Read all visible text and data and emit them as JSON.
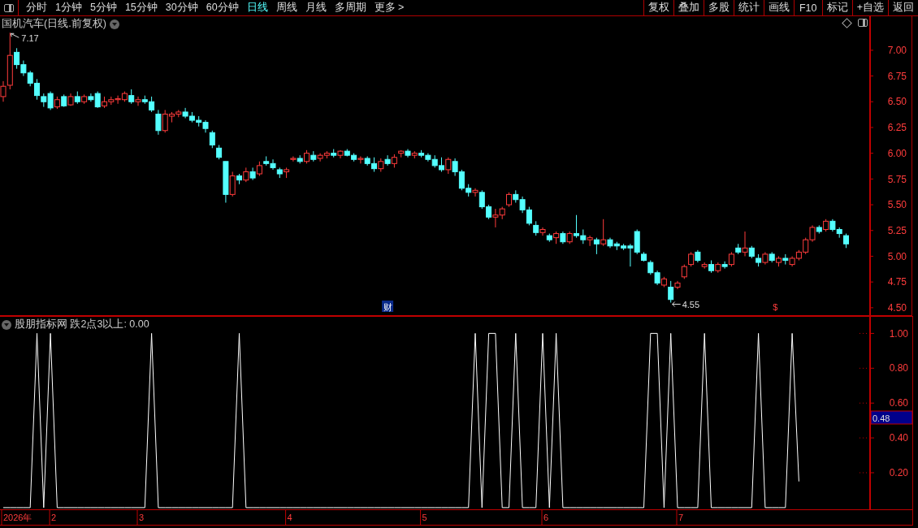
{
  "toolbar": {
    "periods": [
      {
        "label": "分时",
        "selected": false
      },
      {
        "label": "1分钟",
        "selected": false
      },
      {
        "label": "5分钟",
        "selected": false
      },
      {
        "label": "15分钟",
        "selected": false
      },
      {
        "label": "30分钟",
        "selected": false
      },
      {
        "label": "60分钟",
        "selected": false
      },
      {
        "label": "日线",
        "selected": true
      },
      {
        "label": "周线",
        "selected": false
      },
      {
        "label": "月线",
        "selected": false
      },
      {
        "label": "多周期",
        "selected": false
      },
      {
        "label": "更多 >",
        "selected": false
      }
    ],
    "actions": [
      "复权",
      "叠加",
      "多股",
      "统计",
      "画线",
      "F10",
      "标记",
      "+自选",
      "返回"
    ]
  },
  "main_chart": {
    "title": "国机汽车(日线.前复权)",
    "high_label": "7.17",
    "low_label": "4.55",
    "event_badges": [
      {
        "label": "财",
        "kind": "finance"
      },
      {
        "label": "$",
        "kind": "dividend"
      }
    ],
    "chart_data": {
      "type": "candlestick",
      "yticks": [
        {
          "value": 7,
          "label": "7.00"
        },
        {
          "value": 6.75,
          "label": "6.75"
        },
        {
          "value": 6.5,
          "label": "6.50"
        },
        {
          "value": 6.25,
          "label": "6.25"
        },
        {
          "value": 6,
          "label": "6.00"
        },
        {
          "value": 5.75,
          "label": "5.75"
        },
        {
          "value": 5.5,
          "label": "5.50"
        },
        {
          "value": 5.25,
          "label": "5.25"
        },
        {
          "value": 5,
          "label": "5.00"
        },
        {
          "value": 4.75,
          "label": "4.75"
        },
        {
          "value": 4.5,
          "label": "4.50"
        }
      ],
      "ylim": [
        4.42,
        7.33
      ],
      "categories": [
        null,
        null,
        null,
        null,
        null,
        null,
        null,
        null,
        null,
        null,
        null,
        null,
        null,
        null,
        null,
        null,
        null,
        null,
        null,
        null,
        null,
        null,
        null,
        null,
        null,
        null,
        null,
        null,
        null,
        null,
        null,
        null,
        null,
        null,
        null,
        null,
        null,
        null,
        null,
        null,
        null,
        null,
        null,
        null,
        null,
        null,
        null,
        null,
        null,
        null,
        null,
        null,
        null,
        null,
        null,
        null,
        null,
        null,
        null,
        null,
        null,
        null,
        null,
        null,
        null,
        null,
        null,
        null,
        null,
        null,
        null,
        null,
        null,
        null,
        null,
        null,
        null,
        null,
        null,
        null,
        null,
        null,
        null,
        null,
        null,
        null,
        null,
        null,
        null,
        null,
        null,
        null,
        null,
        null,
        null,
        null,
        null,
        null,
        null,
        null,
        null,
        null,
        null,
        null,
        null,
        null,
        null,
        null,
        null,
        null,
        null,
        null,
        null,
        null,
        null,
        null,
        null,
        null,
        null,
        null,
        null,
        null,
        null,
        null,
        null,
        null
      ],
      "ohlc": [
        [
          6.55,
          6.7,
          6.5,
          6.65
        ],
        [
          6.66,
          7.17,
          6.62,
          6.95
        ],
        [
          6.98,
          7.02,
          6.82,
          6.86
        ],
        [
          6.86,
          6.9,
          6.75,
          6.78
        ],
        [
          6.78,
          6.8,
          6.65,
          6.68
        ],
        [
          6.68,
          6.72,
          6.52,
          6.56
        ],
        [
          6.55,
          6.58,
          6.45,
          6.5
        ],
        [
          6.58,
          6.6,
          6.42,
          6.44
        ],
        [
          6.45,
          6.55,
          6.43,
          6.52
        ],
        [
          6.55,
          6.57,
          6.45,
          6.46
        ],
        [
          6.47,
          6.58,
          6.46,
          6.55
        ],
        [
          6.55,
          6.6,
          6.48,
          6.5
        ],
        [
          6.5,
          6.57,
          6.48,
          6.55
        ],
        [
          6.55,
          6.58,
          6.5,
          6.52
        ],
        [
          6.58,
          6.6,
          6.44,
          6.45
        ],
        [
          6.46,
          6.55,
          6.44,
          6.5
        ],
        [
          6.5,
          6.55,
          6.47,
          6.52
        ],
        [
          6.52,
          6.56,
          6.48,
          6.53
        ],
        [
          6.52,
          6.6,
          6.5,
          6.58
        ],
        [
          6.56,
          6.62,
          6.48,
          6.5
        ],
        [
          6.5,
          6.55,
          6.46,
          6.52
        ],
        [
          6.52,
          6.56,
          6.48,
          6.5
        ],
        [
          6.5,
          6.55,
          6.4,
          6.42
        ],
        [
          6.38,
          6.42,
          6.18,
          6.22
        ],
        [
          6.22,
          6.42,
          6.2,
          6.38
        ],
        [
          6.36,
          6.4,
          6.3,
          6.38
        ],
        [
          6.38,
          6.42,
          6.35,
          6.4
        ],
        [
          6.4,
          6.44,
          6.34,
          6.36
        ],
        [
          6.36,
          6.4,
          6.3,
          6.32
        ],
        [
          6.32,
          6.36,
          6.26,
          6.3
        ],
        [
          6.3,
          6.32,
          6.2,
          6.24
        ],
        [
          6.2,
          6.22,
          6.05,
          6.08
        ],
        [
          6.05,
          6.08,
          5.94,
          5.96
        ],
        [
          5.92,
          5.92,
          5.52,
          5.6
        ],
        [
          5.6,
          5.82,
          5.58,
          5.78
        ],
        [
          5.78,
          5.8,
          5.7,
          5.74
        ],
        [
          5.74,
          5.86,
          5.72,
          5.82
        ],
        [
          5.82,
          5.86,
          5.74,
          5.76
        ],
        [
          5.8,
          5.92,
          5.78,
          5.88
        ],
        [
          5.92,
          5.97,
          5.88,
          5.9
        ],
        [
          5.9,
          5.94,
          5.84,
          5.86
        ],
        [
          5.84,
          5.86,
          5.76,
          5.8
        ],
        [
          5.82,
          5.86,
          5.76,
          5.84
        ],
        [
          5.94,
          5.97,
          5.92,
          5.95
        ],
        [
          5.95,
          5.98,
          5.9,
          5.92
        ],
        [
          5.92,
          6.03,
          5.9,
          6.0
        ],
        [
          5.98,
          6.02,
          5.92,
          5.94
        ],
        [
          5.95,
          6.0,
          5.92,
          5.98
        ],
        [
          5.98,
          6.02,
          5.95,
          6.0
        ],
        [
          6.0,
          6.04,
          5.96,
          5.98
        ],
        [
          5.98,
          6.03,
          5.95,
          6.02
        ],
        [
          6.02,
          6.04,
          5.97,
          5.98
        ],
        [
          5.98,
          6.0,
          5.92,
          5.94
        ],
        [
          5.94,
          5.97,
          5.9,
          5.95
        ],
        [
          5.95,
          5.97,
          5.88,
          5.9
        ],
        [
          5.9,
          5.96,
          5.82,
          5.85
        ],
        [
          5.85,
          5.95,
          5.82,
          5.92
        ],
        [
          5.94,
          5.98,
          5.88,
          5.9
        ],
        [
          5.9,
          5.99,
          5.86,
          5.96
        ],
        [
          6.0,
          6.03,
          5.96,
          6.02
        ],
        [
          6.02,
          6.04,
          5.96,
          5.98
        ],
        [
          5.98,
          6.02,
          5.95,
          6.0
        ],
        [
          6.0,
          6.03,
          5.96,
          5.98
        ],
        [
          5.98,
          6.0,
          5.92,
          5.94
        ],
        [
          5.94,
          5.98,
          5.86,
          5.88
        ],
        [
          5.88,
          5.96,
          5.82,
          5.84
        ],
        [
          5.84,
          5.96,
          5.8,
          5.94
        ],
        [
          5.92,
          5.95,
          5.78,
          5.82
        ],
        [
          5.82,
          5.84,
          5.64,
          5.66
        ],
        [
          5.66,
          5.7,
          5.58,
          5.62
        ],
        [
          5.62,
          5.66,
          5.58,
          5.64
        ],
        [
          5.62,
          5.64,
          5.46,
          5.48
        ],
        [
          5.48,
          5.5,
          5.36,
          5.38
        ],
        [
          5.38,
          5.46,
          5.28,
          5.4
        ],
        [
          5.4,
          5.48,
          5.36,
          5.46
        ],
        [
          5.5,
          5.62,
          5.48,
          5.6
        ],
        [
          5.6,
          5.64,
          5.52,
          5.55
        ],
        [
          5.55,
          5.58,
          5.42,
          5.45
        ],
        [
          5.45,
          5.48,
          5.3,
          5.32
        ],
        [
          5.3,
          5.34,
          5.2,
          5.23
        ],
        [
          5.23,
          5.28,
          5.2,
          5.26
        ],
        [
          5.2,
          5.22,
          5.14,
          5.16
        ],
        [
          5.18,
          5.24,
          5.12,
          5.22
        ],
        [
          5.22,
          5.24,
          5.12,
          5.14
        ],
        [
          5.14,
          5.24,
          5.12,
          5.22
        ],
        [
          5.22,
          5.4,
          5.18,
          5.2
        ],
        [
          5.2,
          5.26,
          5.12,
          5.16
        ],
        [
          5.16,
          5.2,
          5.1,
          5.18
        ],
        [
          5.16,
          5.18,
          5.02,
          5.12
        ],
        [
          5.12,
          5.36,
          5.1,
          5.16
        ],
        [
          5.16,
          5.18,
          5.08,
          5.1
        ],
        [
          5.12,
          5.14,
          5.06,
          5.1
        ],
        [
          5.1,
          5.12,
          5.06,
          5.08
        ],
        [
          5.1,
          5.12,
          4.9,
          5.08
        ],
        [
          5.24,
          5.26,
          5.02,
          5.04
        ],
        [
          5.02,
          5.04,
          4.95,
          4.96
        ],
        [
          4.94,
          4.96,
          4.82,
          4.84
        ],
        [
          4.84,
          4.86,
          4.72,
          4.74
        ],
        [
          4.72,
          4.8,
          4.7,
          4.78
        ],
        [
          4.7,
          4.76,
          4.55,
          4.58
        ],
        [
          4.7,
          4.76,
          4.68,
          4.74
        ],
        [
          4.8,
          4.92,
          4.78,
          4.9
        ],
        [
          4.92,
          5.04,
          4.9,
          5.02
        ],
        [
          5.04,
          5.06,
          4.94,
          4.96
        ],
        [
          4.9,
          4.94,
          4.88,
          4.92
        ],
        [
          4.92,
          4.96,
          4.84,
          4.86
        ],
        [
          4.86,
          4.94,
          4.84,
          4.92
        ],
        [
          4.92,
          4.95,
          4.88,
          4.9
        ],
        [
          4.92,
          5.04,
          4.9,
          5.02
        ],
        [
          5.08,
          5.12,
          5.02,
          5.04
        ],
        [
          5.04,
          5.24,
          5.0,
          5.08
        ],
        [
          5.08,
          5.1,
          4.98,
          5.0
        ],
        [
          4.98,
          5.02,
          4.9,
          4.94
        ],
        [
          4.94,
          5.04,
          4.92,
          5.02
        ],
        [
          5.02,
          5.04,
          4.94,
          4.96
        ],
        [
          4.94,
          5.0,
          4.9,
          4.98
        ],
        [
          4.98,
          5.02,
          4.92,
          4.96
        ],
        [
          4.92,
          5.0,
          4.9,
          4.98
        ],
        [
          4.98,
          5.06,
          4.96,
          5.04
        ],
        [
          5.04,
          5.18,
          5.02,
          5.16
        ],
        [
          5.16,
          5.3,
          5.14,
          5.28
        ],
        [
          5.28,
          5.3,
          5.22,
          5.24
        ],
        [
          5.26,
          5.36,
          5.24,
          5.34
        ],
        [
          5.34,
          5.36,
          5.24,
          5.26
        ],
        [
          5.26,
          5.28,
          5.18,
          5.22
        ],
        [
          5.2,
          5.22,
          5.08,
          5.12
        ]
      ]
    }
  },
  "indicator": {
    "title": "股朋指标网 跌2点3以上: 0.00",
    "cursor_value": "0.48",
    "chart_data": {
      "type": "line",
      "ylim": [
        -0.01,
        1.1
      ],
      "categories": [
        null,
        null,
        null,
        null,
        null,
        null,
        null,
        null,
        null,
        null,
        null,
        null,
        null,
        null,
        null,
        null,
        null,
        null,
        null,
        null,
        null,
        null,
        null,
        null,
        null,
        null,
        null,
        null,
        null,
        null,
        null,
        null,
        null,
        null,
        null,
        null,
        null,
        null,
        null,
        null,
        null,
        null,
        null,
        null,
        null,
        null,
        null,
        null,
        null,
        null,
        null,
        null,
        null,
        null,
        null,
        null,
        null,
        null,
        null,
        null,
        null,
        null,
        null,
        null,
        null,
        null,
        null,
        null,
        null,
        null,
        null,
        null,
        null,
        null,
        null,
        null,
        null,
        null,
        null,
        null,
        null,
        null,
        null,
        null,
        null,
        null,
        null,
        null,
        null,
        null,
        null,
        null,
        null,
        null,
        null,
        null,
        null,
        null,
        null,
        null,
        null,
        null,
        null,
        null,
        null,
        null,
        null,
        null,
        null,
        null,
        null,
        null,
        null,
        null,
        null,
        null,
        null,
        null,
        null
      ],
      "yticks": [
        {
          "value": 0.2,
          "label": "0.20"
        },
        {
          "value": 0.4,
          "label": "0.40"
        },
        {
          "value": 0.6,
          "label": "0.60"
        },
        {
          "value": 0.8,
          "label": "0.80"
        },
        {
          "value": 1,
          "label": "1.00"
        }
      ],
      "series": [
        {
          "color": "#ffffff",
          "values": [
            0,
            0,
            0,
            0,
            0,
            1,
            0,
            1,
            0,
            0,
            0,
            0,
            0,
            0,
            0,
            0,
            0,
            0,
            0,
            0,
            0,
            0,
            1,
            0,
            0,
            0,
            0,
            0,
            0,
            0,
            0,
            0,
            0,
            0,
            0,
            1,
            0,
            0,
            0,
            0,
            0,
            0,
            0,
            0,
            0,
            0,
            0,
            0,
            0,
            0,
            0,
            0,
            0,
            0,
            0,
            0,
            0,
            0,
            0,
            0,
            0,
            0,
            0,
            0,
            0,
            0,
            0,
            0,
            0,
            0,
            1,
            0,
            1,
            1,
            0,
            0,
            1,
            0,
            0,
            0,
            1,
            0,
            1,
            0,
            0,
            0,
            0,
            0,
            0,
            0,
            0,
            0,
            0,
            0,
            0,
            0,
            1,
            1,
            0,
            1,
            0,
            0,
            0,
            0,
            1,
            0,
            0,
            0,
            0,
            0,
            0,
            0,
            1,
            0,
            0,
            0,
            0,
            1,
            0.15
          ]
        }
      ]
    }
  },
  "date_axis": [
    "2026年",
    "2",
    "3",
    "4",
    "5",
    "6",
    "7"
  ]
}
